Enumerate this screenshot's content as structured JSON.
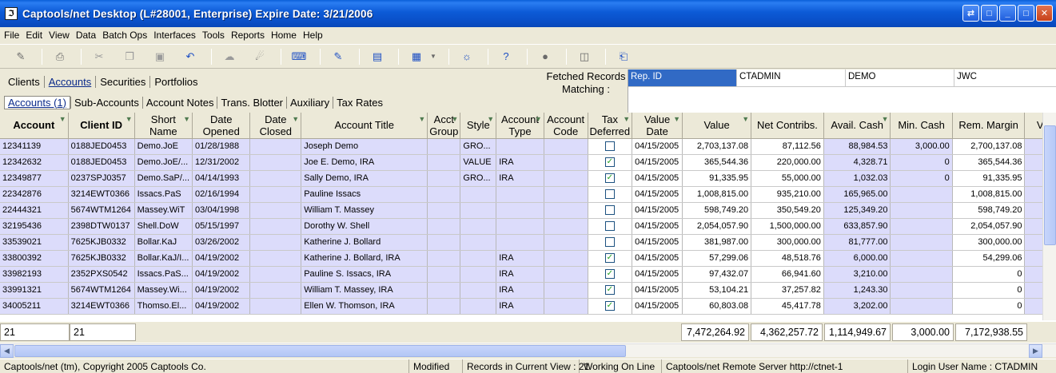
{
  "window": {
    "title": "Captools/net Desktop  (L#28001, Enterprise) Expire Date: 3/21/2006",
    "app_icon": "captools-icon"
  },
  "menu": [
    "File",
    "Edit",
    "View",
    "Data",
    "Batch Ops",
    "Interfaces",
    "Tools",
    "Reports",
    "Home",
    "Help"
  ],
  "tabs_primary": [
    "Clients",
    "Accounts",
    "Securities",
    "Portfolios"
  ],
  "tabs_secondary": [
    "Accounts (1)",
    "Sub-Accounts",
    "Account Notes",
    "Trans. Blotter",
    "Auxiliary",
    "Tax Rates"
  ],
  "fetched_label": "Fetched Records Matching :",
  "filter": {
    "field": "Rep. ID",
    "values": [
      "CTADMIN",
      "DEMO",
      "JWC"
    ]
  },
  "columns": [
    "Account",
    "Client ID",
    "Short Name",
    "Date Opened",
    "Date Closed",
    "Account Title",
    "Acct Group",
    "Style",
    "Account Type",
    "Account Code",
    "Tax Deferred",
    "Value Date",
    "Value",
    "Net Contribs.",
    "Avail. Cash",
    "Min. Cash",
    "Rem. Margin",
    "V"
  ],
  "rows": [
    [
      "12341139",
      "0188JED0453",
      "Demo.JoE",
      "01/28/1988",
      "",
      "Joseph Demo",
      "",
      "GRO...",
      "",
      "",
      false,
      "04/15/2005",
      "2,703,137.08",
      "87,112.56",
      "88,984.53",
      "3,000.00",
      "2,700,137.08"
    ],
    [
      "12342632",
      "0188JED0453",
      "Demo.JoE/...",
      "12/31/2002",
      "",
      "Joe E. Demo, IRA",
      "",
      "VALUE",
      "IRA",
      "",
      true,
      "04/15/2005",
      "365,544.36",
      "220,000.00",
      "4,328.71",
      "0",
      "365,544.36"
    ],
    [
      "12349877",
      "0237SPJ0357",
      "Demo.SaP/...",
      "04/14/1993",
      "",
      "Sally Demo, IRA",
      "",
      "GRO...",
      "IRA",
      "",
      true,
      "04/15/2005",
      "91,335.95",
      "55,000.00",
      "1,032.03",
      "0",
      "91,335.95"
    ],
    [
      "22342876",
      "3214EWT0366",
      "Issacs.PaS",
      "02/16/1994",
      "",
      "Pauline Issacs",
      "",
      "",
      "",
      "",
      false,
      "04/15/2005",
      "1,008,815.00",
      "935,210.00",
      "165,965.00",
      "",
      "1,008,815.00"
    ],
    [
      "22444321",
      "5674WTM1264",
      "Massey.WiT",
      "03/04/1998",
      "",
      "William T. Massey",
      "",
      "",
      "",
      "",
      false,
      "04/15/2005",
      "598,749.20",
      "350,549.20",
      "125,349.20",
      "",
      "598,749.20"
    ],
    [
      "32195436",
      "2398DTW0137",
      "Shell.DoW",
      "05/15/1997",
      "",
      "Dorothy W. Shell",
      "",
      "",
      "",
      "",
      false,
      "04/15/2005",
      "2,054,057.90",
      "1,500,000.00",
      "633,857.90",
      "",
      "2,054,057.90"
    ],
    [
      "33539021",
      "7625KJB0332",
      "Bollar.KaJ",
      "03/26/2002",
      "",
      "Katherine J. Bollard",
      "",
      "",
      "",
      "",
      false,
      "04/15/2005",
      "381,987.00",
      "300,000.00",
      "81,777.00",
      "",
      "300,000.00"
    ],
    [
      "33800392",
      "7625KJB0332",
      "Bollar.KaJ/I...",
      "04/19/2002",
      "",
      "Katherine J. Bollard, IRA",
      "",
      "",
      "IRA",
      "",
      true,
      "04/15/2005",
      "57,299.06",
      "48,518.76",
      "6,000.00",
      "",
      "54,299.06"
    ],
    [
      "33982193",
      "2352PXS0542",
      "Issacs.PaS...",
      "04/19/2002",
      "",
      "Pauline S. Issacs, IRA",
      "",
      "",
      "IRA",
      "",
      true,
      "04/15/2005",
      "97,432.07",
      "66,941.60",
      "3,210.00",
      "",
      "0"
    ],
    [
      "33991321",
      "5674WTM1264",
      "Massey.Wi...",
      "04/19/2002",
      "",
      "William T. Massey, IRA",
      "",
      "",
      "IRA",
      "",
      true,
      "04/15/2005",
      "53,104.21",
      "37,257.82",
      "1,243.30",
      "",
      "0"
    ],
    [
      "34005211",
      "3214EWT0366",
      "Thomso.El...",
      "04/19/2002",
      "",
      "Ellen W. Thomson, IRA",
      "",
      "",
      "IRA",
      "",
      true,
      "04/15/2005",
      "60,803.08",
      "45,417.78",
      "3,202.00",
      "",
      "0"
    ]
  ],
  "totals": {
    "account_count": "21",
    "client_count": "21",
    "value": "7,472,264.92",
    "net_contribs": "4,362,257.72",
    "avail_cash": "1,114,949.67",
    "min_cash": "3,000.00",
    "rem_margin": "7,172,938.55"
  },
  "status": [
    "Captools/net (tm), Copyright 2005 Captools Co.",
    "Modified",
    "Records in Current View : 21",
    "Working On Line",
    "Captools/net Remote Server http://ctnet-1",
    "Login User Name : CTADMIN"
  ],
  "toolbar_icons": [
    "edit-icon",
    "print-icon",
    "cut-icon",
    "copy-icon",
    "paste-icon",
    "undo-icon",
    "refresh-icon",
    "search-icon",
    "keyboard-icon",
    "notepad-icon",
    "form-icon",
    "grid-icon",
    "dropdown-icon",
    "globe-icon",
    "help-icon",
    "record-icon",
    "calculator-icon",
    "exit-icon"
  ]
}
